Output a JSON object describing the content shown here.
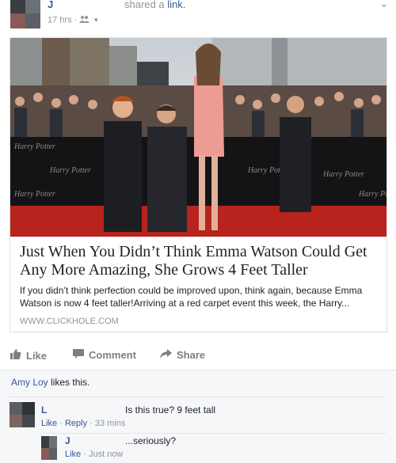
{
  "post": {
    "author": "J",
    "action_prefix": "shared a ",
    "action_link": "link.",
    "time": "17 hrs · ",
    "menu_icon": "chevron-down-icon"
  },
  "link": {
    "title": "Just When You Didn’t Think Emma Watson Could Get Any More Amazing, She Grows 4 Feet Taller",
    "description": "If you didn’t think perfection could be improved upon, think again, because Emma Watson is now 4 feet taller!Arriving at a red carpet event this week, the Harry...",
    "domain": "WWW.CLICKHOLE.COM",
    "backdrop_text": "Harry Potter"
  },
  "actions": {
    "like": "Like",
    "comment": "Comment",
    "share": "Share"
  },
  "likes": {
    "name": "Amy Loy",
    "suffix": " likes this."
  },
  "comments": [
    {
      "author": "L",
      "text": "Is this true? 9 feet tall",
      "like_label": "Like",
      "reply_label": "Reply",
      "time": "33 mins"
    },
    {
      "author": "J",
      "text": "...seriously?",
      "like_label": "Like",
      "time": "Just now"
    }
  ],
  "colors": {
    "link_blue": "#365899",
    "meta_gray": "#90949c",
    "red_carpet": "#b8231d"
  }
}
